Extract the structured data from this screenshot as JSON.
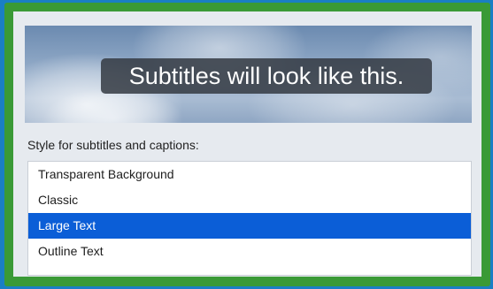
{
  "preview": {
    "sample_text": "Subtitles will look like this."
  },
  "styles_section": {
    "label": "Style for subtitles and captions:",
    "items": [
      {
        "label": "Transparent Background",
        "selected": false
      },
      {
        "label": "Classic",
        "selected": false
      },
      {
        "label": "Large Text",
        "selected": true
      },
      {
        "label": "Outline Text",
        "selected": false
      }
    ]
  },
  "colors": {
    "selection": "#0b5ed7",
    "outer_frame": "#3a9a36",
    "background": "#1a7fc4"
  }
}
